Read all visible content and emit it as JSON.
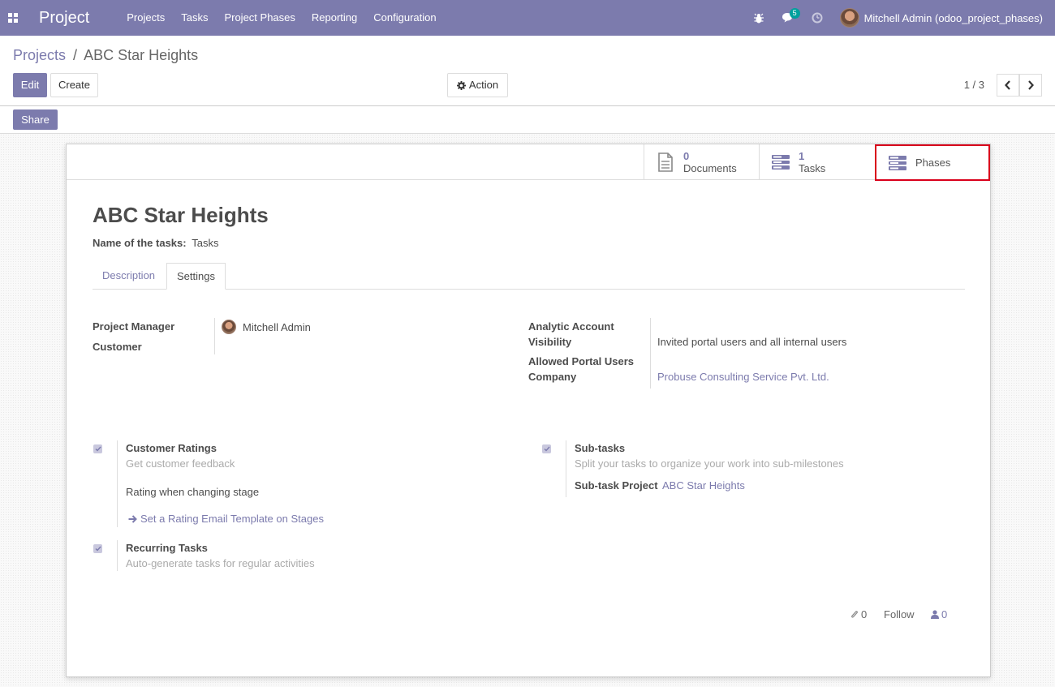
{
  "navbar": {
    "brand": "Project",
    "menu": [
      "Projects",
      "Tasks",
      "Project Phases",
      "Reporting",
      "Configuration"
    ],
    "messages_count": "5",
    "user_name": "Mitchell Admin (odoo_project_phases)"
  },
  "breadcrumb": {
    "parent": "Projects",
    "separator": "/",
    "current": "ABC Star Heights"
  },
  "buttons": {
    "edit": "Edit",
    "create": "Create",
    "action": "Action",
    "share": "Share"
  },
  "pager": {
    "value": "1 / 3"
  },
  "smart_buttons": {
    "documents": {
      "count": "0",
      "label": "Documents"
    },
    "tasks": {
      "count": "1",
      "label": "Tasks"
    },
    "phases": {
      "label": "Phases"
    }
  },
  "record": {
    "title": "ABC Star Heights",
    "task_name_label": "Name of the tasks:",
    "task_name_value": "Tasks"
  },
  "tabs": [
    "Description",
    "Settings"
  ],
  "settings": {
    "project_manager_label": "Project Manager",
    "project_manager_value": "Mitchell Admin",
    "customer_label": "Customer",
    "analytic_account_label": "Analytic Account",
    "visibility_label": "Visibility",
    "visibility_value": "Invited portal users and all internal users",
    "allowed_portal_label": "Allowed Portal Users",
    "company_label": "Company",
    "company_value": "Probuse Consulting Service Pvt. Ltd."
  },
  "options": {
    "customer_ratings": {
      "title": "Customer Ratings",
      "help": "Get customer feedback",
      "rating_mode": "Rating when changing stage",
      "template_link": "Set a Rating Email Template on Stages"
    },
    "recurring": {
      "title": "Recurring Tasks",
      "help": "Auto-generate tasks for regular activities"
    },
    "subtasks": {
      "title": "Sub-tasks",
      "help": "Split your tasks to organize your work into sub-milestones",
      "project_label": "Sub-task Project",
      "project_value": "ABC Star Heights"
    }
  },
  "chatter": {
    "attachments": "0",
    "follow": "Follow",
    "followers": "0"
  },
  "colors": {
    "brand": "#7c7bad",
    "highlight": "#d9001b",
    "badge": "#00a09d"
  }
}
